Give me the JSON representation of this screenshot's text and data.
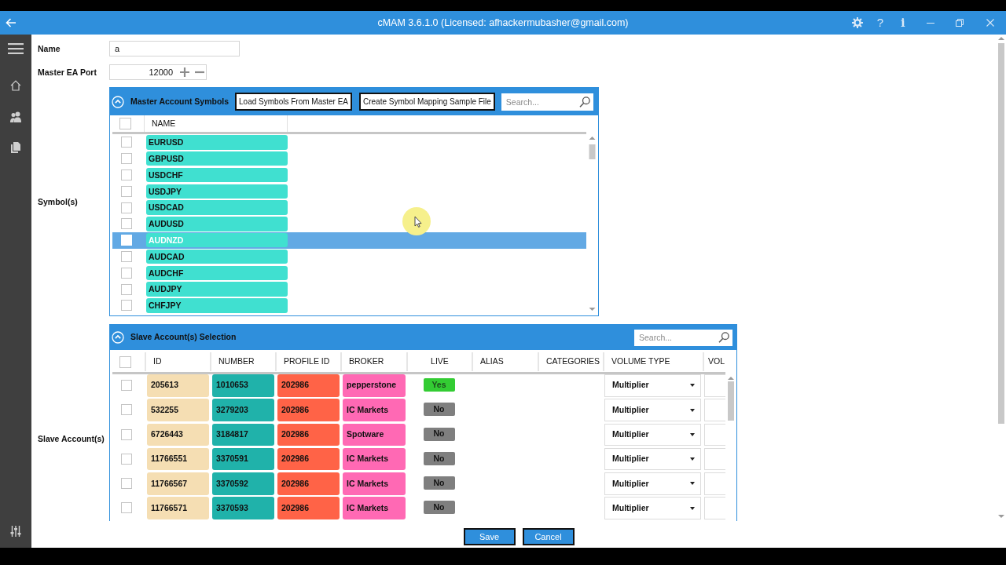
{
  "window": {
    "title": "cMAM 3.6.1.0 (Licensed: afhackermubasher@gmail.com)",
    "help": "?",
    "info": "i"
  },
  "form": {
    "name": {
      "label": "Name",
      "value": "a"
    },
    "master_ea_port": {
      "label": "Master EA Port",
      "value": "12000"
    },
    "symbols_label": "Symbol(s)",
    "slave_accounts_label": "Slave Account(s)"
  },
  "master_account_symbols": {
    "title": "Master Account Symbols",
    "expanded": true,
    "buttons": [
      "Load Symbols From Master EA",
      "Create Symbol Mapping Sample File"
    ],
    "search": {
      "placeholder": "Search..."
    },
    "select_all_checked": false,
    "columns": [
      "NAME"
    ],
    "rows": [
      {
        "name": "EURUSD",
        "checked": false,
        "selected": false
      },
      {
        "name": "GBPUSD",
        "checked": false,
        "selected": false
      },
      {
        "name": "USDCHF",
        "checked": false,
        "selected": false
      },
      {
        "name": "USDJPY",
        "checked": false,
        "selected": false
      },
      {
        "name": "USDCAD",
        "checked": false,
        "selected": false
      },
      {
        "name": "AUDUSD",
        "checked": false,
        "selected": false
      },
      {
        "name": "AUDNZD",
        "checked": false,
        "selected": true
      },
      {
        "name": "AUDCAD",
        "checked": false,
        "selected": false
      },
      {
        "name": "AUDCHF",
        "checked": false,
        "selected": false
      },
      {
        "name": "AUDJPY",
        "checked": false,
        "selected": false
      },
      {
        "name": "CHFJPY",
        "checked": false,
        "selected": false
      }
    ]
  },
  "slave_accounts": {
    "title": "Slave Account(s) Selection",
    "expanded": true,
    "search": {
      "placeholder": "Search..."
    },
    "select_all_checked": false,
    "columns": [
      "ID",
      "NUMBER",
      "PROFILE ID",
      "BROKER",
      "LIVE",
      "ALIAS",
      "CATEGORIES",
      "VOLUME TYPE",
      "VOL"
    ],
    "rows": [
      {
        "checked": false,
        "id": "205613",
        "number": "1010653",
        "profile_id": "202986",
        "broker": "pepperstone",
        "live": {
          "label": "Yes",
          "on": true
        },
        "volume_type": "Multiplier"
      },
      {
        "checked": false,
        "id": "532255",
        "number": "3279203",
        "profile_id": "202986",
        "broker": "IC Markets",
        "live": {
          "label": "No",
          "on": false
        },
        "volume_type": "Multiplier"
      },
      {
        "checked": false,
        "id": "6726443",
        "number": "3184817",
        "profile_id": "202986",
        "broker": "Spotware",
        "live": {
          "label": "No",
          "on": false
        },
        "volume_type": "Multiplier"
      },
      {
        "checked": false,
        "id": "11766551",
        "number": "3370591",
        "profile_id": "202986",
        "broker": "IC Markets",
        "live": {
          "label": "No",
          "on": false
        },
        "volume_type": "Multiplier"
      },
      {
        "checked": false,
        "id": "11766567",
        "number": "3370592",
        "profile_id": "202986",
        "broker": "IC Markets",
        "live": {
          "label": "No",
          "on": false
        },
        "volume_type": "Multiplier"
      },
      {
        "checked": false,
        "id": "11766571",
        "number": "3370593",
        "profile_id": "202986",
        "broker": "IC Markets",
        "live": {
          "label": "No",
          "on": false
        },
        "volume_type": "Multiplier"
      }
    ]
  },
  "actions": [
    "Save",
    "Cancel"
  ]
}
